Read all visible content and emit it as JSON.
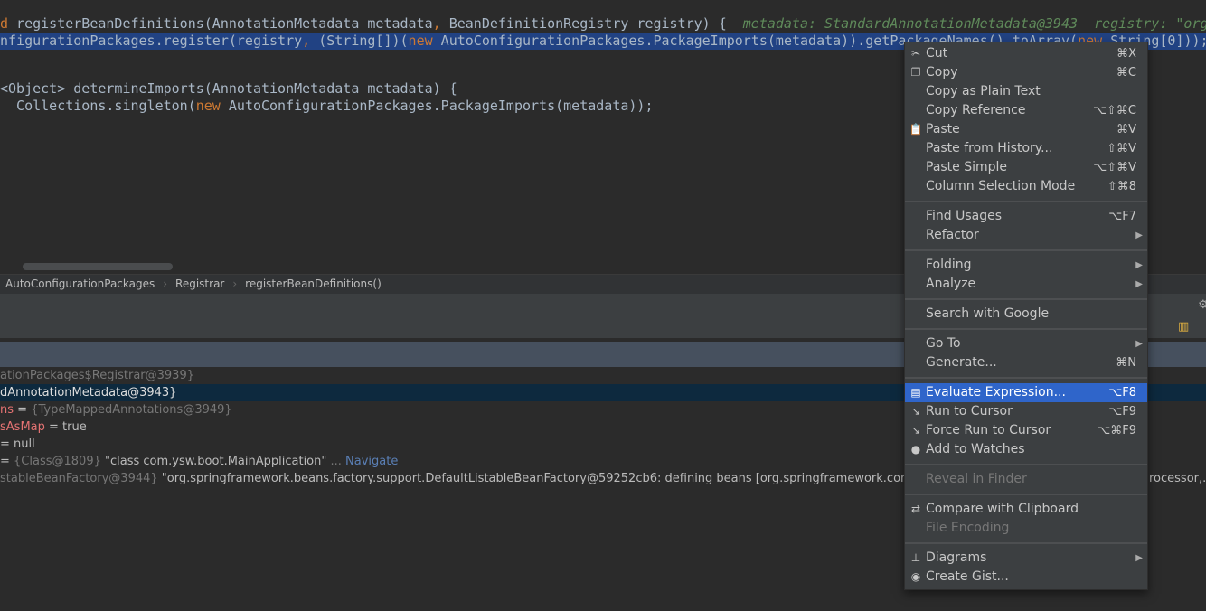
{
  "editor": {
    "line1": {
      "kw": "d",
      "text": " registerBeanDefinitions(AnnotationMetadata metadata",
      "comma": ",",
      "rest": " BeanDefinitionRegistry registry) {",
      "hint": "metadata: StandardAnnotationMetadata@3943  registry: \"org"
    },
    "line2": {
      "a": "nfigurationPackages.register(registry",
      "comma": ",",
      "b": " (String[])(",
      "kw": "new",
      "c": " AutoConfigurationPackages.PackageImports(metadata)).getPackageNames().toArray(",
      "kw2": "new",
      "d": " String[0]));"
    },
    "line4": "<Object> determineImports(AnnotationMetadata metadata) {",
    "line5": {
      "a": "  Collections.singleton(",
      "kw": "new",
      "b": " AutoConfigurationPackages.PackageImports(metadata));"
    }
  },
  "breadcrumb": [
    "AutoConfigurationPackages",
    "Registrar",
    "registerBeanDefinitions()"
  ],
  "variables": [
    {
      "value": "ationPackages$Registrar@3939}",
      "muted": true
    },
    {
      "value": "dAnnotationMetadata@3943}",
      "selected": true
    },
    {
      "key": "ns",
      "eq": " = ",
      "type": "{TypeMappedAnnotations@3949}"
    },
    {
      "key": "sAsMap",
      "eq": " = ",
      "value": "true"
    },
    {
      "eq": "= ",
      "value": "null"
    },
    {
      "eq": " = ",
      "type": "{Class@1809}",
      "value": " \"class com.ysw.boot.MainApplication\"",
      "more": " ...",
      "link": "Navigate"
    },
    {
      "type": "stableBeanFactory@3944}",
      "value": " \"org.springframework.beans.factory.support.DefaultListableBeanFactory@59252cb6: defining beans [org.springframework.context.an",
      "tail": "rocessor,..."
    }
  ],
  "menu": [
    {
      "label": "Cut",
      "shortcut": "⌘X",
      "icon": "scissors-icon",
      "glyph": "✂"
    },
    {
      "label": "Copy",
      "shortcut": "⌘C",
      "icon": "copy-icon",
      "glyph": "❐"
    },
    {
      "label": "Copy as Plain Text"
    },
    {
      "label": "Copy Reference",
      "shortcut": "⌥⇧⌘C"
    },
    {
      "label": "Paste",
      "shortcut": "⌘V",
      "icon": "paste-icon",
      "glyph": "📋"
    },
    {
      "label": "Paste from History...",
      "shortcut": "⇧⌘V"
    },
    {
      "label": "Paste Simple",
      "shortcut": "⌥⇧⌘V"
    },
    {
      "label": "Column Selection Mode",
      "shortcut": "⇧⌘8"
    },
    {
      "sep": true
    },
    {
      "label": "Find Usages",
      "shortcut": "⌥F7"
    },
    {
      "label": "Refactor",
      "submenu": true
    },
    {
      "sep": true
    },
    {
      "label": "Folding",
      "submenu": true
    },
    {
      "label": "Analyze",
      "submenu": true
    },
    {
      "sep": true
    },
    {
      "label": "Search with Google"
    },
    {
      "sep": true
    },
    {
      "label": "Go To",
      "submenu": true
    },
    {
      "label": "Generate...",
      "shortcut": "⌘N"
    },
    {
      "sep": true
    },
    {
      "label": "Evaluate Expression...",
      "shortcut": "⌥F8",
      "icon": "calculator-icon",
      "glyph": "▤",
      "highlighted": true
    },
    {
      "label": "Run to Cursor",
      "shortcut": "⌥F9",
      "icon": "run-to-cursor-icon",
      "glyph": "↘"
    },
    {
      "label": "Force Run to Cursor",
      "shortcut": "⌥⌘F9",
      "icon": "force-run-to-cursor-icon",
      "glyph": "↘"
    },
    {
      "label": "Add to Watches",
      "icon": "watches-icon",
      "glyph": "●"
    },
    {
      "sep": true
    },
    {
      "label": "Reveal in Finder",
      "disabled": true
    },
    {
      "sep": true
    },
    {
      "label": "Compare with Clipboard",
      "icon": "compare-icon",
      "glyph": "⇄"
    },
    {
      "label": "File Encoding",
      "disabled": true
    },
    {
      "sep": true
    },
    {
      "label": "Diagrams",
      "submenu": true,
      "icon": "diagram-icon",
      "glyph": "⊥"
    },
    {
      "label": "Create Gist...",
      "icon": "github-icon",
      "glyph": "◉"
    }
  ],
  "colors": {
    "highlight": "#2f65ca",
    "selection": "#214283",
    "keyword": "#cc7832"
  }
}
